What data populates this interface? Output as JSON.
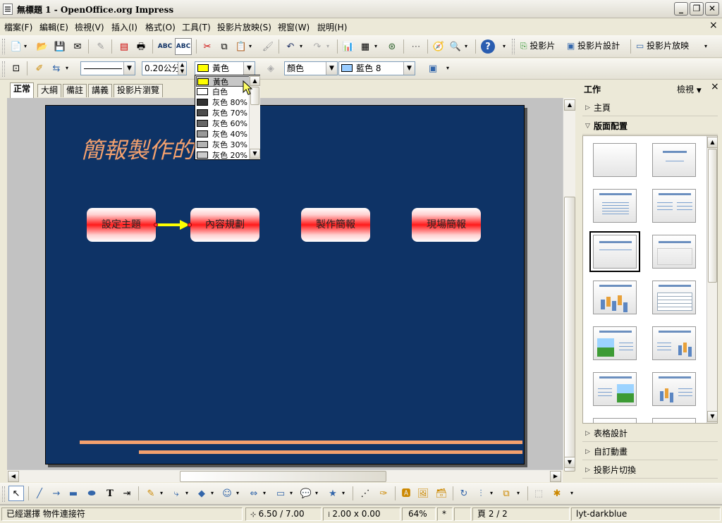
{
  "window": {
    "title": "無標題 1 - OpenOffice.org Impress",
    "min": "_",
    "restore": "❐",
    "close": "✕"
  },
  "menu": [
    "檔案(F)",
    "編輯(E)",
    "檢視(V)",
    "插入(I)",
    "格式(O)",
    "工具(T)",
    "投影片放映(S)",
    "視窗(W)",
    "說明(H)"
  ],
  "menu_close": "×",
  "toolbar1": {
    "slide_btn": "投影片",
    "design_btn": "投影片設計",
    "show_btn": "投影片放映"
  },
  "toolbar2": {
    "line_width": "0.20公分",
    "line_color": "黃色",
    "area_style": "顏色",
    "area_color": "藍色 8",
    "yellow": "#ffff00",
    "blue8": "#99ccff"
  },
  "tabs": [
    "正常",
    "大綱",
    "備註",
    "講義",
    "投影片瀏覽"
  ],
  "color_list": [
    {
      "name": "黃色",
      "color": "#ffff00"
    },
    {
      "name": "白色",
      "color": "#ffffff"
    },
    {
      "name": "灰色 80%",
      "color": "#333333"
    },
    {
      "name": "灰色 70%",
      "color": "#4c4c4c"
    },
    {
      "name": "灰色 60%",
      "color": "#666666"
    },
    {
      "name": "灰色 40%",
      "color": "#999999"
    },
    {
      "name": "灰色 30%",
      "color": "#b2b2b2"
    },
    {
      "name": "灰色 20%",
      "color": "#cccccc"
    }
  ],
  "slide": {
    "title": "簡報製作的",
    "boxes": [
      "設定主題",
      "內容規劃",
      "製作簡報",
      "現場簡報"
    ],
    "background": "#0e3366",
    "accent": "#f4a16e"
  },
  "tasks": {
    "title": "工作",
    "view": "檢視",
    "sections": {
      "master": "主頁",
      "layouts": "版面配置",
      "table": "表格設計",
      "animation": "自訂動畫",
      "transition": "投影片切換"
    }
  },
  "status": {
    "selection": "已經選擇 物件連接符",
    "position": "6.50 / 7.00",
    "size": "2.00 x 0.00",
    "zoom": "64%",
    "modified": "*",
    "page": "頁 2 / 2",
    "layout": "lyt-darkblue"
  }
}
